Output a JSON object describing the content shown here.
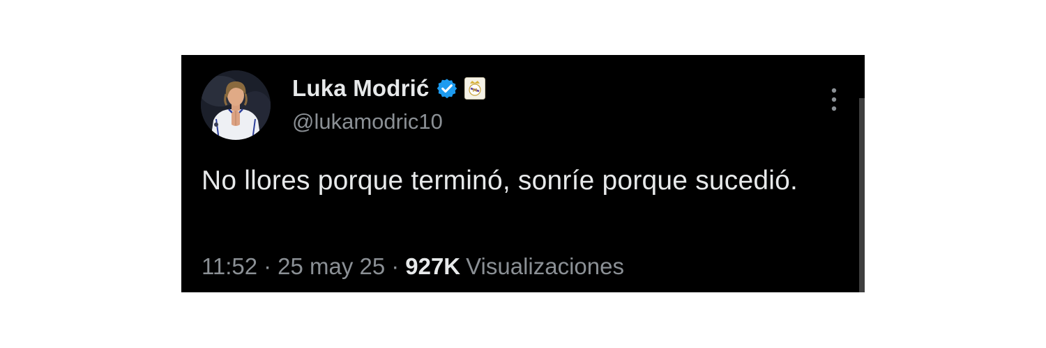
{
  "tweet": {
    "author": {
      "display_name": "Luka Modrić",
      "handle": "@lukamodric10",
      "verified": true,
      "affiliation_badge": "real-madrid-crest-icon"
    },
    "text": "No llores porque terminó, sonríe porque sucedió.",
    "time": "11:52",
    "date": "25 may 25",
    "separator": "·",
    "views_count": "927K",
    "views_label": "Visualizaciones"
  },
  "icons": {
    "verified": "verified-badge-icon",
    "more": "more-vertical-icon"
  },
  "colors": {
    "background": "#000000",
    "primary_text": "#e7e9ea",
    "secondary_text": "#8b9095",
    "verified_blue": "#1d9bf0"
  }
}
